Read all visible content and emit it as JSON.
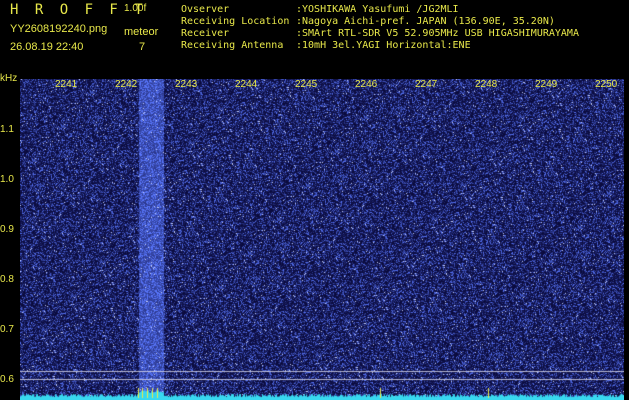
{
  "header": {
    "app_name": "H R O F F T",
    "version": "1.00f",
    "filename": "YY2608192240.png",
    "mode": "meteor",
    "timestamp": "26.08.19 22:40",
    "count": "7"
  },
  "info": [
    {
      "key": "Ovserver",
      "value": ":YOSHIKAWA Yasufumi /JG2MLI"
    },
    {
      "key": "Receiving Location",
      "value": ":Nagoya Aichi-pref. JAPAN (136.90E, 35.20N)"
    },
    {
      "key": "Receiver",
      "value": ":SMArt RTL-SDR V5 52.905MHz USB HIGASHIMURAYAMA"
    },
    {
      "key": "Receiving Antenna",
      "value": ":10mH 3el.YAGI Horizontal:ENE"
    }
  ],
  "axis": {
    "y_unit": "kHz",
    "y_ticks": [
      "1.1",
      "1.0",
      "0.9",
      "0.8",
      "0.7",
      "0.6"
    ],
    "x_ticks": [
      "2241",
      "2242",
      "2243",
      "2244",
      "2245",
      "2246",
      "2247",
      "2248",
      "2249",
      "2250"
    ]
  },
  "colors": {
    "text": "#e8e84a",
    "background": "#000000",
    "noise": "#1a1aa0",
    "trace": "#38d8f0"
  }
}
